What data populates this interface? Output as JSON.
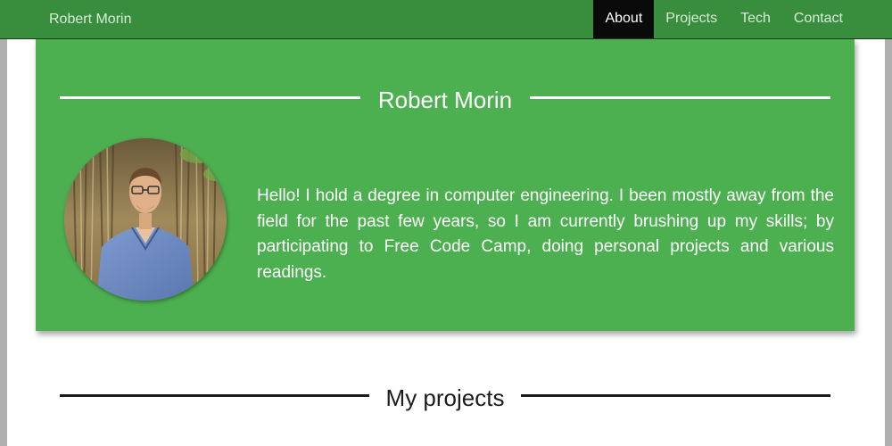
{
  "nav": {
    "brand": "Robert Morin",
    "items": [
      {
        "label": "About",
        "active": true
      },
      {
        "label": "Projects",
        "active": false
      },
      {
        "label": "Tech",
        "active": false
      },
      {
        "label": "Contact",
        "active": false
      }
    ]
  },
  "about": {
    "title": "Robert Morin",
    "text": "Hello! I hold a degree in computer engineering. I been mostly away from the field for the past few years, so I am currently brushing up my skills; by participating to Free Code Camp, doing personal projects and various readings."
  },
  "projects": {
    "title": "My projects"
  },
  "colors": {
    "nav_bg": "#388e3c",
    "card_bg": "#4caf50",
    "active_nav": "#0a0a0a"
  }
}
